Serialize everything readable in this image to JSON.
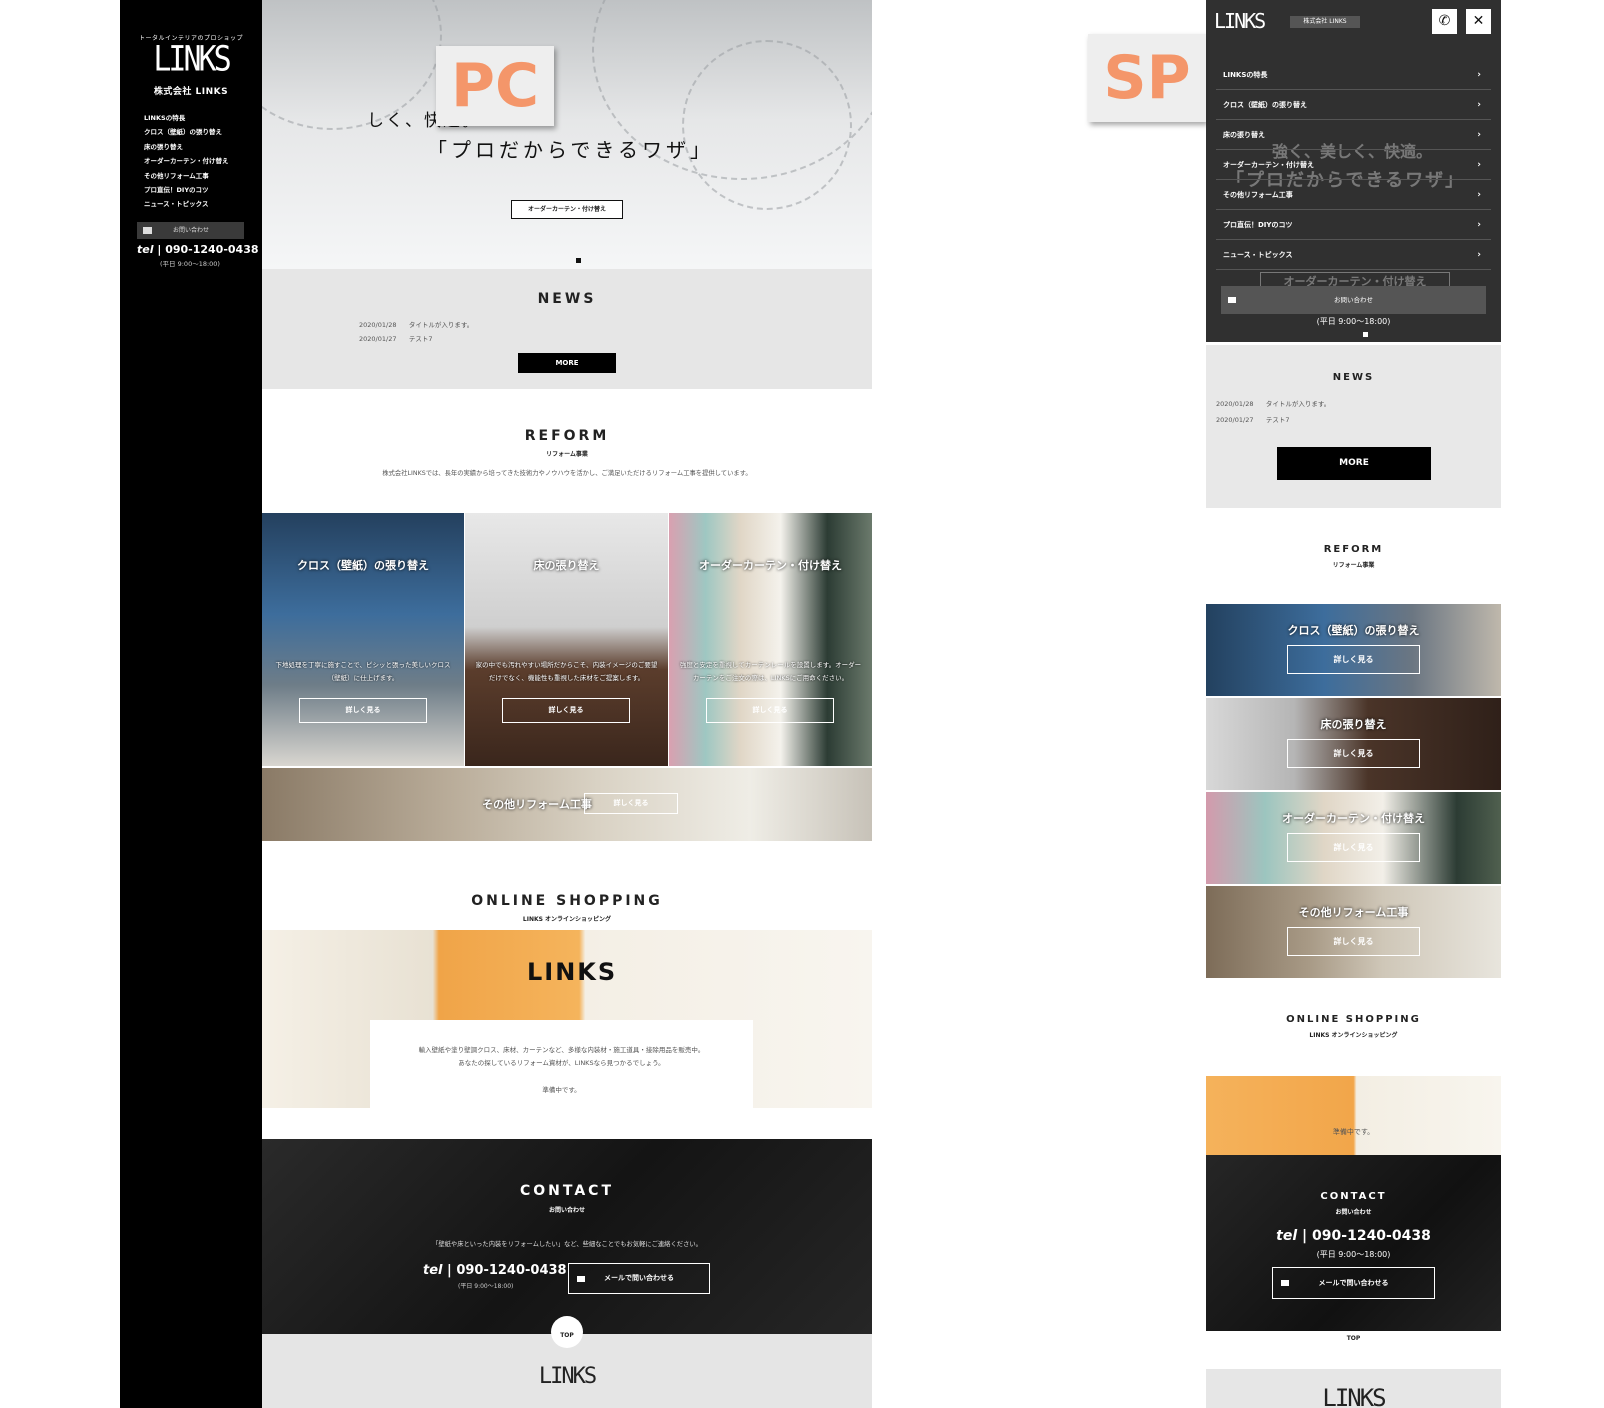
{
  "labels": {
    "pc": "PC",
    "sp": "SP"
  },
  "brand": {
    "tagline": "トータルインテリアのプロショップ",
    "logo": "LINKS",
    "company": "株式会社 LINKS"
  },
  "nav": [
    "LINKSの特長",
    "クロス（壁紙）の張り替え",
    "床の張り替え",
    "オーダーカーテン・付け替え",
    "その他リフォーム工事",
    "プロ直伝！DIYのコツ",
    "ニュース・トピックス"
  ],
  "contact_button": "お問い合わせ",
  "tel": "090-1240-0438",
  "tel_prefix": "tel",
  "hours": "(平日 9:00〜18:00)",
  "hero": {
    "line1": "しく、快適。",
    "line2": "「プロだからできるワザ」",
    "button": "オーダーカーテン・付け替え"
  },
  "news": {
    "heading": "NEWS",
    "items": [
      {
        "date": "2020/01/28",
        "title": "タイトルが入ります。"
      },
      {
        "date": "2020/01/27",
        "title": "テスト7"
      }
    ],
    "more": "MORE"
  },
  "reform": {
    "heading": "REFORM",
    "sub": "リフォーム事業",
    "lead": "株式会社LINKSでは、長年の実績から培ってきた技術力やノウハウを活かし、ご満足いただけるリフォーム工事を提供しています。",
    "cards": [
      {
        "title": "クロス（壁紙）の張り替え",
        "desc": "下地処理を丁寧に施すことで、ピシッと張った美しいクロス（壁紙）に仕上げます。",
        "button": "詳しく見る"
      },
      {
        "title": "床の張り替え",
        "desc": "家の中でも汚れやすい場所だからこそ、内装イメージのご要望だけでなく、機能性も重視した床材をご提案します。",
        "button": "詳しく見る"
      },
      {
        "title": "オーダーカーテン・付け替え",
        "desc": "強度と安定を重視してカーテンレールを設置します。オーダーカーテンをご注文の際は、LINKSにご用命ください。",
        "button": "詳しく見る"
      },
      {
        "title": "その他リフォーム工事",
        "desc": "",
        "button": "詳しく見る"
      }
    ]
  },
  "shop": {
    "heading": "ONLINE SHOPPING",
    "sub": "LINKS オンラインショッピング",
    "logo": "LINKS",
    "text1": "輸入壁紙や塗り壁調クロス、床材、カーテンなど、多様な内装材・施工道具・接除用品を販売中。",
    "text2": "あなたの探しているリフォーム資材が、LINKSなら見つかるでしょう。",
    "status": "準備中です。"
  },
  "contact": {
    "heading": "CONTACT",
    "sub": "お問い合わせ",
    "lead": "「壁紙や床といった内装をリフォームしたい」など、些細なことでもお気軽にご連絡ください。",
    "mail_button": "メールで問い合わせる"
  },
  "footer": {
    "top": "TOP",
    "logo": "LINKS"
  },
  "sp": {
    "menu_contact": "お問い合わせ",
    "phone_icon": "phone-icon",
    "close_icon": "close-icon",
    "hero_ghost1": "強く、美しく、快適。",
    "hero_ghost2": "「プロだからできるワザ」",
    "hero_ghost_btn": "オーダーカーテン・付け替え"
  }
}
